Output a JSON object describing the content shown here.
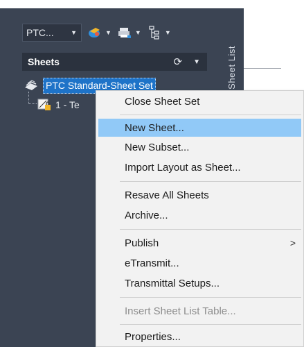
{
  "toolbar": {
    "sheet_set_value": "PTC..."
  },
  "panel": {
    "sheets_header": "Sheets",
    "sidebar_label": "Sheet List"
  },
  "tree": {
    "root_label": "PTC Standard-Sheet Set",
    "child_label": "1 - Te"
  },
  "menu": {
    "items": [
      {
        "label": "Close Sheet Set"
      },
      {
        "label": "New Sheet..."
      },
      {
        "label": "New Subset..."
      },
      {
        "label": "Import Layout as Sheet..."
      },
      {
        "label": "Resave All Sheets"
      },
      {
        "label": "Archive..."
      },
      {
        "label": "Publish"
      },
      {
        "label": "eTransmit..."
      },
      {
        "label": "Transmittal Setups..."
      },
      {
        "label": "Insert Sheet List Table..."
      },
      {
        "label": "Properties..."
      }
    ],
    "highlighted": "New Sheet...",
    "disabled": "Insert Sheet List Table...",
    "submenu_arrow": ">"
  },
  "colors": {
    "panel_bg": "#3b4453",
    "selection": "#1e73c8",
    "menu_highlight": "#91c9f7"
  }
}
